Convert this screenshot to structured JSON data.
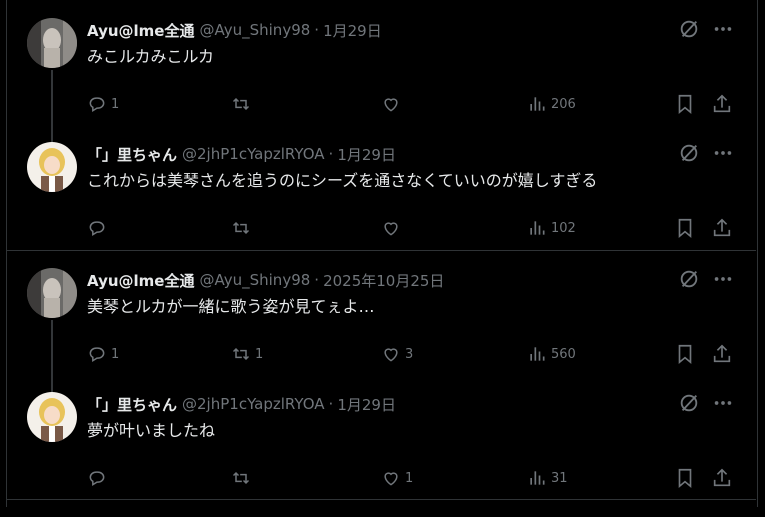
{
  "posts": [
    {
      "name": "Ayu@lme全通",
      "handle": "@Ayu_Shiny98",
      "dot": "·",
      "date": "1月29日",
      "text": "みこルカみこルカ",
      "reply_count": "1",
      "retweet_count": "",
      "like_count": "",
      "views": "206"
    },
    {
      "name": "「」里ちゃん",
      "handle": "@2jhP1cYapzlRYOA",
      "dot": "·",
      "date": "1月29日",
      "text": "これからは美琴さんを追うのにシーズを通さなくていいのが嬉しすぎる",
      "reply_count": "",
      "retweet_count": "",
      "like_count": "",
      "views": "102"
    },
    {
      "name": "Ayu@lme全通",
      "handle": "@Ayu_Shiny98",
      "dot": "·",
      "date": "2025年10月25日",
      "text": "美琴とルカが一緒に歌う姿が見てぇよ…",
      "reply_count": "1",
      "retweet_count": "1",
      "like_count": "3",
      "views": "560"
    },
    {
      "name": "「」里ちゃん",
      "handle": "@2jhP1cYapzlRYOA",
      "dot": "·",
      "date": "1月29日",
      "text": "夢が叶いましたね",
      "reply_count": "",
      "retweet_count": "",
      "like_count": "1",
      "views": "31"
    }
  ],
  "colors": {
    "background": "#000000",
    "text_primary": "#e7e9ea",
    "text_secondary": "#71767b",
    "border": "#2f3336"
  },
  "icons": [
    "reply-icon",
    "retweet-icon",
    "like-icon",
    "views-icon",
    "bookmark-icon",
    "share-icon",
    "grok-icon",
    "more-icon"
  ]
}
